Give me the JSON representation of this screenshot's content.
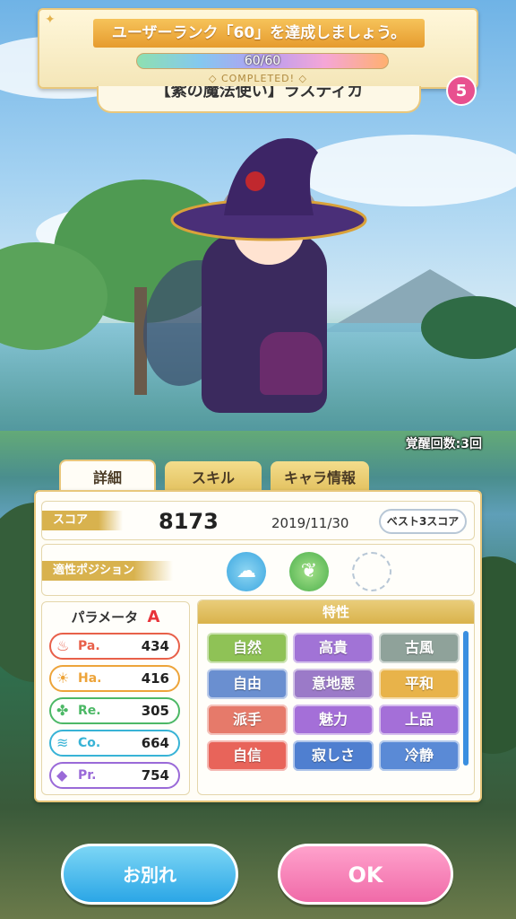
{
  "quest": {
    "title": "ユーザーランク「60」を達成しましょう。",
    "progress_text": "60/60",
    "progress_fraction": 1.0,
    "status": "COMPLETED!"
  },
  "character": {
    "name": "【紫の魔法使い】ラスティカ",
    "awakening_text": "覚醒回数:3回"
  },
  "badge_count": "5",
  "tabs": [
    {
      "label": "詳細",
      "active": true
    },
    {
      "label": "スキル",
      "active": false
    },
    {
      "label": "キャラ情報",
      "active": false
    }
  ],
  "score": {
    "label": "スコア",
    "value": "8173",
    "date": "2019/11/30",
    "best3_label": "ベスト3スコア"
  },
  "position": {
    "label": "適性ポジション"
  },
  "parameters": {
    "title": "パラメータ",
    "rank": "A",
    "rows": [
      {
        "name": "Pa.",
        "value": "434",
        "color": "#e8604a",
        "icon": "flame-icon",
        "glyph": "♨"
      },
      {
        "name": "Ha.",
        "value": "416",
        "color": "#eda43a",
        "icon": "sun-icon",
        "glyph": "☀"
      },
      {
        "name": "Re.",
        "value": "305",
        "color": "#4cb866",
        "icon": "clover-icon",
        "glyph": "✤"
      },
      {
        "name": "Co.",
        "value": "664",
        "color": "#38b3d6",
        "icon": "wind-icon",
        "glyph": "≋"
      },
      {
        "name": "Pr.",
        "value": "754",
        "color": "#9a6ad8",
        "icon": "diamond-icon",
        "glyph": "◆"
      }
    ]
  },
  "traits": {
    "title": "特性",
    "items": [
      {
        "label": "自然",
        "color": "#8fc256"
      },
      {
        "label": "高貴",
        "color": "#a173d6"
      },
      {
        "label": "古風",
        "color": "#8fa29a"
      },
      {
        "label": "自由",
        "color": "#6a8fd0"
      },
      {
        "label": "意地悪",
        "color": "#9b7ac8"
      },
      {
        "label": "平和",
        "color": "#e8b34a"
      },
      {
        "label": "派手",
        "color": "#e67a6a"
      },
      {
        "label": "魅力",
        "color": "#a46fd8"
      },
      {
        "label": "上品",
        "color": "#a46fd8"
      },
      {
        "label": "自信",
        "color": "#e8645a"
      },
      {
        "label": "寂しさ",
        "color": "#4f7fd0"
      },
      {
        "label": "冷静",
        "color": "#5a8ad6"
      }
    ]
  },
  "buttons": {
    "farewell": "お別れ",
    "ok": "OK"
  }
}
